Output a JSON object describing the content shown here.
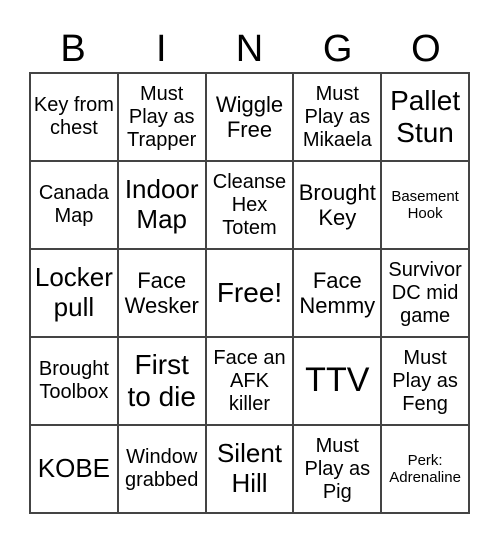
{
  "header": [
    "B",
    "I",
    "N",
    "G",
    "O"
  ],
  "cells": [
    [
      "Key from chest",
      "Must Play as Trapper",
      "Wiggle Free",
      "Must Play as Mikaela",
      "Pallet Stun"
    ],
    [
      "Canada Map",
      "Indoor Map",
      "Cleanse Hex Totem",
      "Brought Key",
      "Basement Hook"
    ],
    [
      "Locker pull",
      "Face Wesker",
      "Free!",
      "Face Nemmy",
      "Survivor DC mid game"
    ],
    [
      "Brought Toolbox",
      "First to die",
      "Face an AFK killer",
      "TTV",
      "Must Play as Feng"
    ],
    [
      "KOBE",
      "Window grabbed",
      "Silent Hill",
      "Must Play as Pig",
      "Perk: Adrenaline"
    ]
  ]
}
